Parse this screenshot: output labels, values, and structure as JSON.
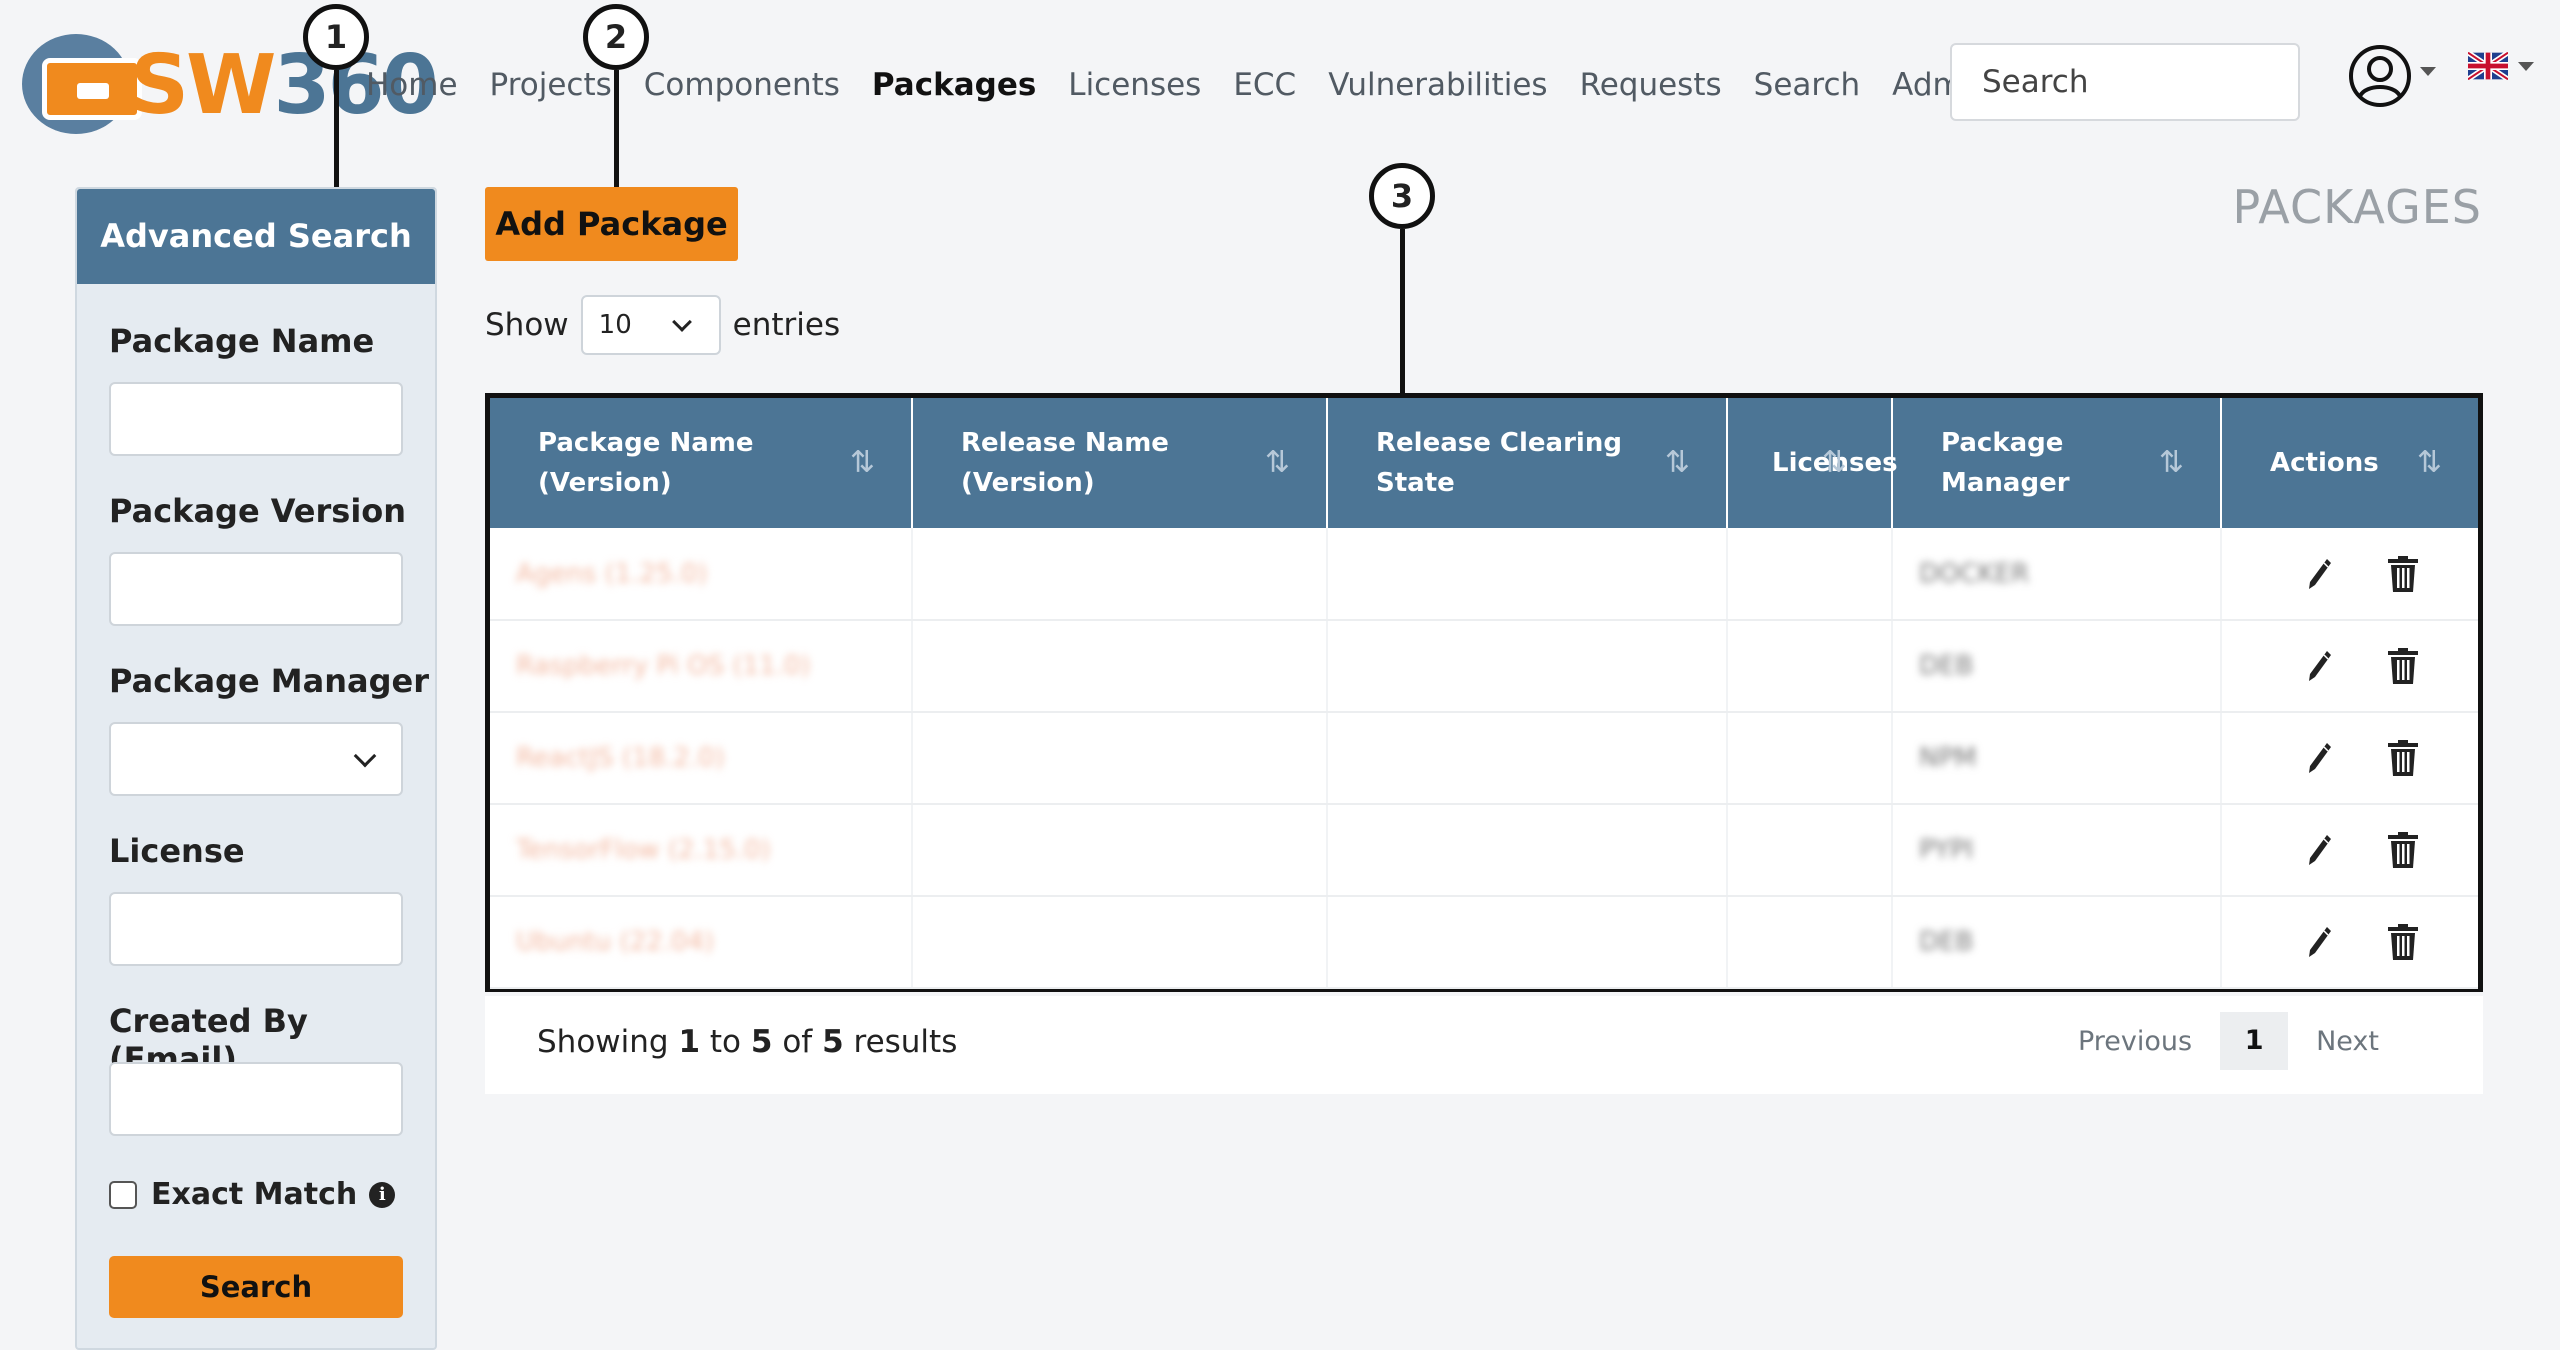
{
  "brand": {
    "prefix": "SW",
    "number": "360"
  },
  "nav": {
    "home": "Home",
    "projects": "Projects",
    "components": "Components",
    "packages": "Packages",
    "licenses": "Licenses",
    "ecc": "ECC",
    "vulnerabilities": "Vulnerabilities",
    "requests": "Requests",
    "search": "Search",
    "admin": "Admin"
  },
  "top_search": {
    "placeholder": "Search"
  },
  "callouts": [
    "1",
    "2",
    "3"
  ],
  "sidebar": {
    "title": "Advanced Search",
    "fields": [
      "Package Name",
      "Package Version",
      "Package Manager",
      "License",
      "Created By (Email)"
    ],
    "exact_match": "Exact Match",
    "info_icon": "i",
    "search_button": "Search"
  },
  "add_package": "Add Package",
  "page_title": "PACKAGES",
  "show": {
    "prefix": "Show",
    "value": "10",
    "suffix": "entries"
  },
  "table": {
    "headers": [
      "Package Name (Version)",
      "Release Name (Version)",
      "Release Clearing State",
      "Licenses",
      "Package Manager",
      "Actions"
    ],
    "sort_icon": "⇅",
    "rows": [
      {
        "package": "Agens (1.25.0)",
        "release": "",
        "state": "",
        "licenses": "",
        "manager": "DOCKER"
      },
      {
        "package": "Raspberry Pi OS (11.0)",
        "release": "",
        "state": "",
        "licenses": "",
        "manager": "DEB"
      },
      {
        "package": "ReactJS (18.2.0)",
        "release": "",
        "state": "",
        "licenses": "",
        "manager": "NPM"
      },
      {
        "package": "TensorFlow (2.15.0)",
        "release": "",
        "state": "",
        "licenses": "",
        "manager": "PYPI"
      },
      {
        "package": "Ubuntu (22.04)",
        "release": "",
        "state": "",
        "licenses": "",
        "manager": "DEB"
      }
    ]
  },
  "footer": {
    "showing": "Showing",
    "from": "1",
    "to_word": "to",
    "to": "5",
    "of_word": "of",
    "total": "5",
    "results": "results",
    "previous": "Previous",
    "current_page": "1",
    "next": "Next"
  },
  "colors": {
    "accent": "#f08a1e",
    "header_blue": "#4c7595"
  },
  "icons": [
    "user-circle-icon",
    "uk-flag-icon",
    "chevron-down-icon",
    "sort-icon",
    "pencil-icon",
    "trash-icon",
    "info-icon"
  ]
}
